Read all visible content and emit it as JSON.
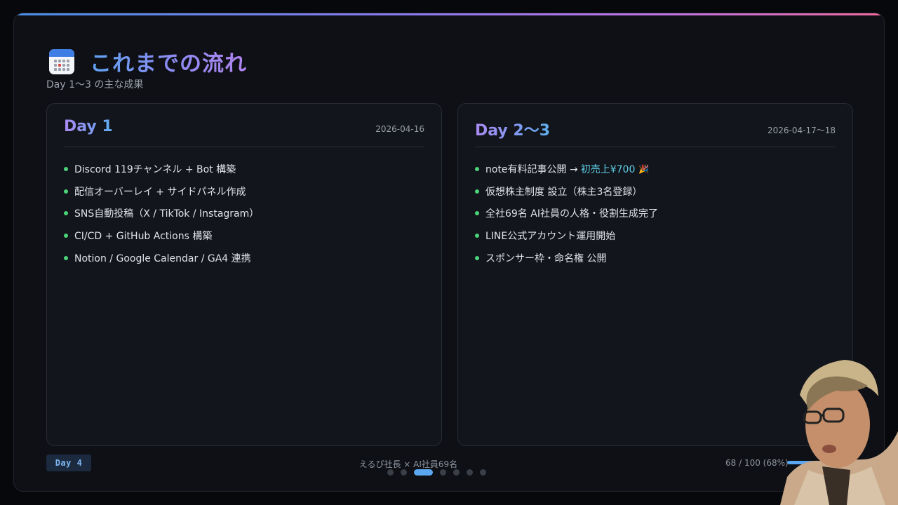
{
  "header": {
    "title_icon": "calendar-icon",
    "title": "これまでの流れ",
    "subtitle": "Day 1〜3 の主な成果"
  },
  "cards": [
    {
      "title": "Day 1",
      "date": "2026-04-16",
      "items": [
        "Discord 119チャンネル + Bot 構築",
        "配信オーバーレイ + サイドパネル作成",
        "SNS自動投稿（X / TikTok / Instagram）",
        "CI/CD + GitHub Actions 構築",
        "Notion / Google Calendar / GA4 連携"
      ]
    },
    {
      "title": "Day 2〜3",
      "date": "2026-04-17〜18",
      "items": [
        "note有料記事公開 →",
        "仮想株主制度 設立（株主3名登録）",
        "全社69名 AI社員の人格・役割生成完了",
        "LINE公式アカウント運用開始",
        "スポンサー枠・命名権 公開"
      ],
      "first_item_highlight": "初売上¥700",
      "first_item_icon": "party-popper-icon"
    }
  ],
  "footer": {
    "day_badge": "Day 4",
    "center_text": "えるぴ社長 × AI社員69名",
    "progress_text": "68 / 100 (68%)",
    "progress_value": 0.68
  },
  "pagination": {
    "total": 7,
    "active_index": 2
  },
  "colors": {
    "accent_blue": "#5aa6f0",
    "bullet_green": "#4bd37a",
    "highlight_cyan": "#5fd0e8"
  }
}
